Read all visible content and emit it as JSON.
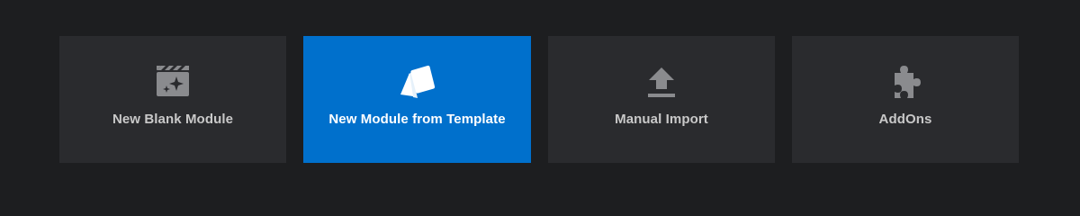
{
  "tiles": [
    {
      "label": "New Blank Module",
      "icon": "clapperboard-sparkle-icon",
      "active": false
    },
    {
      "label": "New Module from Template",
      "icon": "template-cards-icon",
      "active": true
    },
    {
      "label": "Manual Import",
      "icon": "upload-icon",
      "active": false
    },
    {
      "label": "AddOns",
      "icon": "puzzle-piece-icon",
      "active": false
    }
  ],
  "colors": {
    "background": "#1d1e20",
    "tile": "#2a2b2e",
    "active_tile": "#0070cc",
    "icon": "#8a8b8e",
    "label": "#c9c9c9",
    "active_label": "#ffffff"
  }
}
